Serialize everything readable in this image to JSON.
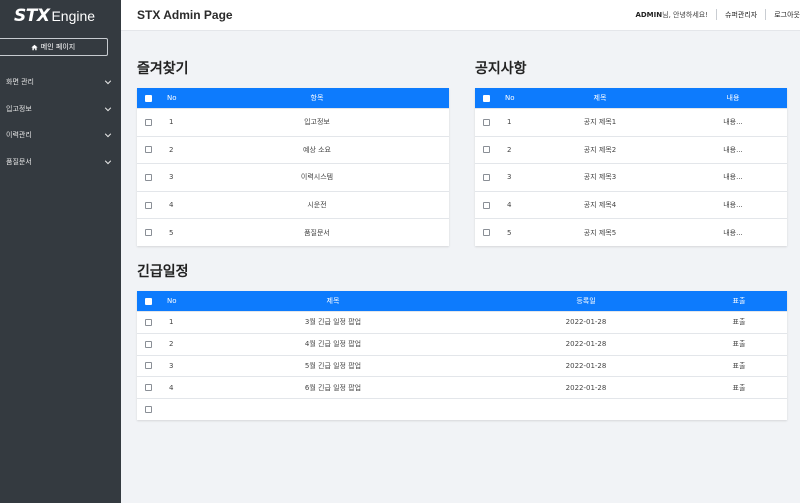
{
  "logo": {
    "stx": "STX",
    "engine": "Engine"
  },
  "header": {
    "title": "STX Admin Page",
    "user_name": "ADMIN",
    "greeting": "님, 안녕하세요!",
    "role": "슈퍼관리자",
    "logout": "로그아웃"
  },
  "sidebar": {
    "main_page_button": "메인 페이지",
    "items": [
      {
        "label": "화면 관리"
      },
      {
        "label": "입고정보"
      },
      {
        "label": "이력관리"
      },
      {
        "label": "품질문서"
      }
    ]
  },
  "favorites": {
    "title": "즐겨찾기",
    "headers": {
      "no": "No",
      "item": "항목"
    },
    "rows": [
      {
        "no": "1",
        "item": "입고정보"
      },
      {
        "no": "2",
        "item": "예상 소요"
      },
      {
        "no": "3",
        "item": "이력시스템"
      },
      {
        "no": "4",
        "item": "시운전"
      },
      {
        "no": "5",
        "item": "품질문서"
      }
    ]
  },
  "notices": {
    "title": "공지사항",
    "headers": {
      "no": "No",
      "subject": "제목",
      "content": "내용"
    },
    "rows": [
      {
        "no": "1",
        "subject": "공지 제목1",
        "content": "내용..."
      },
      {
        "no": "2",
        "subject": "공지 제목2",
        "content": "내용..."
      },
      {
        "no": "3",
        "subject": "공지 제목3",
        "content": "내용..."
      },
      {
        "no": "4",
        "subject": "공지 제목4",
        "content": "내용..."
      },
      {
        "no": "5",
        "subject": "공지 제목5",
        "content": "내용..."
      }
    ]
  },
  "urgent": {
    "title": "긴급일정",
    "headers": {
      "no": "No",
      "subject": "제목",
      "date": "등록일",
      "display": "표출"
    },
    "rows": [
      {
        "no": "1",
        "subject": "3월 긴급 일정 팝업",
        "date": "2022-01-28",
        "display": "표출"
      },
      {
        "no": "2",
        "subject": "4월 긴급 일정 팝업",
        "date": "2022-01-28",
        "display": "표출"
      },
      {
        "no": "3",
        "subject": "5월 긴급 일정 팝업",
        "date": "2022-01-28",
        "display": "표출"
      },
      {
        "no": "4",
        "subject": "6월 긴급 일정 팝업",
        "date": "2022-01-28",
        "display": "표출"
      },
      {
        "no": "",
        "subject": "",
        "date": "",
        "display": ""
      }
    ]
  },
  "colors": {
    "sidebar": "#343a40",
    "table_header": "#0d7bfd",
    "background": "#f1f3f6"
  }
}
